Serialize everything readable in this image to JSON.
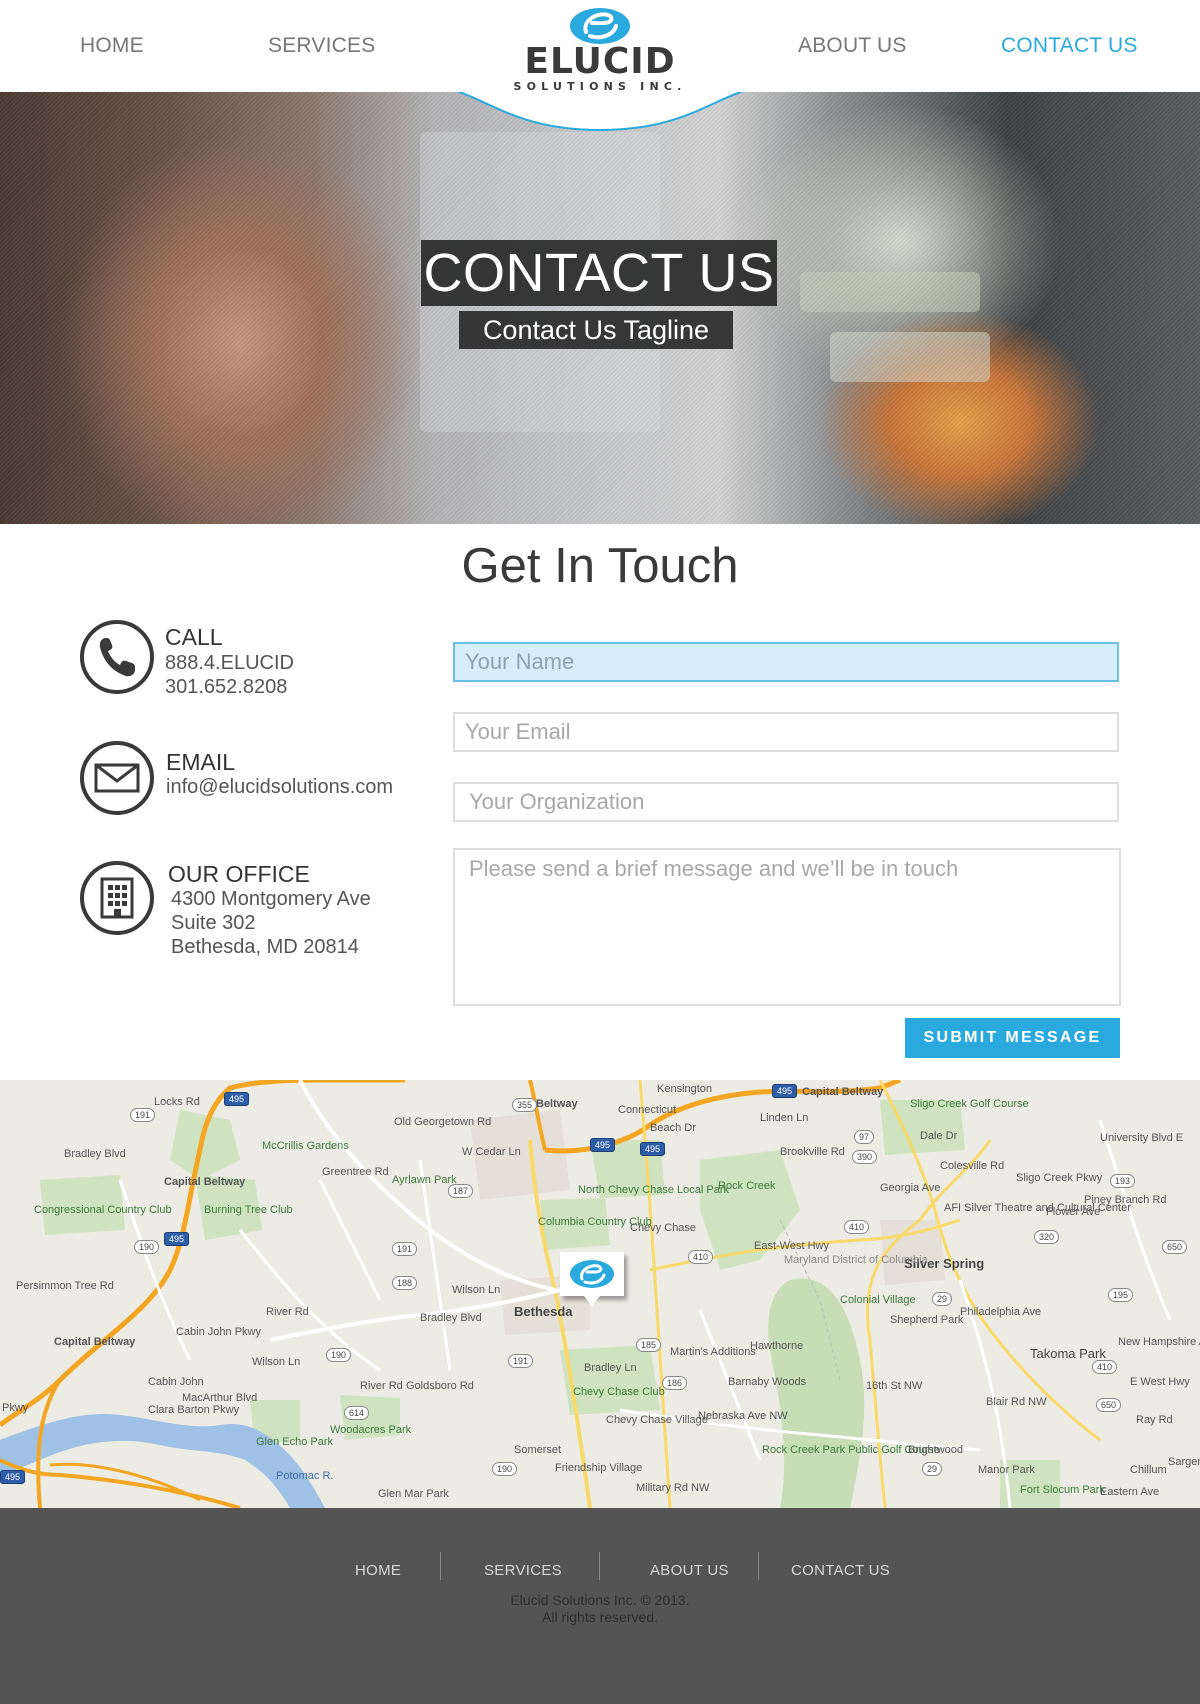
{
  "nav": {
    "home": "HOME",
    "services": "SERVICES",
    "about": "ABOUT US",
    "contact": "CONTACT US"
  },
  "logo": {
    "name": "ELUCID",
    "subtitle": "SOLUTIONS INC.",
    "icon": "elucid-e-mark-icon"
  },
  "hero": {
    "title": "CONTACT US",
    "tagline": "Contact Us Tagline"
  },
  "section_title": "Get In Touch",
  "contact": {
    "call": {
      "heading": "CALL",
      "line1": "888.4.ELUCID",
      "line2": "301.652.8208",
      "icon": "phone-icon"
    },
    "email": {
      "heading": "EMAIL",
      "address": "info@elucidsolutions.com",
      "icon": "envelope-icon"
    },
    "office": {
      "heading": "OUR OFFICE",
      "line1": "4300 Montgomery Ave",
      "line2": "Suite 302",
      "line3": "Bethesda, MD 20814",
      "icon": "building-icon"
    }
  },
  "form": {
    "name_placeholder": "Your Name",
    "email_placeholder": "Your Email",
    "org_placeholder": "Your Organization",
    "message_placeholder": "Please send a brief message and we’ll be in touch",
    "submit_label": "SUBMIT MESSAGE"
  },
  "map": {
    "labels": {
      "kensington": "Kensington",
      "capital_beltway_top": "Capital Beltway",
      "capital_beltway_left": "Capital Beltway",
      "capital_beltway_vert": "Capital Beltway",
      "sligo_creek": "Sligo Creek Golf Course",
      "linden_ln": "Linden Ln",
      "dale_dr": "Dale Dr",
      "mccrillis": "McCrillis Gardens",
      "ayrlawn": "Ayrlawn Park",
      "w_cedar": "W Cedar Ln",
      "north_chevy": "North Chevy Chase Local Park",
      "rock_creek": "Rock Creek",
      "afi": "AFI Silver Theatre and Cultural Center",
      "congressional": "Congressional Country Club",
      "burning_tree": "Burning Tree Club",
      "columbia": "Columbia Country Club",
      "chevy_chase": "Chevy Chase",
      "east_west": "East-West Hwy",
      "silver_spring": "Silver Spring",
      "piney_branch": "Piney Branch Rd",
      "wilson_ln": "Wilson Ln",
      "bethesda": "Bethesda",
      "colonial": "Colonial Village",
      "shepherd": "Shepherd Park",
      "takoma": "Takoma Park",
      "e_west_hwy": "E West Hwy",
      "hawthorne": "Hawthorne",
      "martins": "Martin's Additions",
      "barnaby": "Barnaby Woods",
      "bradley_ln": "Bradley Ln",
      "ccc": "Chevy Chase Club",
      "cabin_john": "Cabin John",
      "macarthur": "MacArthur Blvd",
      "clara_barton": "Clara Barton Pkwy",
      "goldsboro": "Goldsboro Rd",
      "woodacres": "Woodacres Park",
      "glen_echo": "Glen Echo Park",
      "ccv": "Chevy Chase Village",
      "somerset": "Somerset",
      "friendship": "Friendship Village",
      "rcp": "Rock Creek Park Public Golf Course",
      "brightwood": "Brightwood",
      "manor_park": "Manor Park",
      "chillum": "Chillum",
      "fort_slocum": "Fort Slocum Park",
      "military": "Military Rd NW",
      "glen_mar": "Glen Mar Park",
      "potomac": "Potomac R.",
      "pkwy": "Pkwy",
      "river_rd": "River Rd",
      "bradley_blvd": "Bradley Blvd",
      "old_georgetown": "Old Georgetown Rd",
      "greentree": "Greentree Rd",
      "persimmon": "Persimmon Tree Rd",
      "connecticut": "Connecticut",
      "beach_dr": "Beach Dr",
      "brookville": "Brookville Rd",
      "georgia": "Georgia Ave",
      "colesville": "Colesville Rd",
      "sligo_pkwy": "Sligo Creek Pkwy",
      "flower": "Flower Ave",
      "university": "University Blvd E",
      "new_hampshire": "New Hampshire Ave",
      "philadelphia": "Philadelphia Ave",
      "blair": "Blair Rd NW",
      "nebraska": "Nebraska Ave NW",
      "sixteenth": "16th St NW",
      "maryland": "Maryland District of Columbia",
      "ray_rd": "Ray Rd",
      "sargent": "Sargent Rd",
      "eastern": "Eastern Ave",
      "cabin_john_pkwy": "Cabin John Pkwy",
      "locks_rd": "Locks Rd",
      "bradley_blvd2": "Bradley Blvd",
      "river_rd2": "River Rd",
      "wilson_ln2": "Wilson Ln",
      "beltway_top2": "Beltway"
    },
    "shields": {
      "s191a": "191",
      "s355": "355",
      "s495a": "495",
      "s495b": "495",
      "s495c": "495",
      "s495d": "495",
      "s495e": "495",
      "s97": "97",
      "s390": "390",
      "s193": "193",
      "s187": "187",
      "s410a": "410",
      "s410b": "410",
      "s320": "320",
      "s650a": "650",
      "s190a": "190",
      "s191b": "191",
      "s188": "188",
      "s29a": "29",
      "s195": "195",
      "s185": "185",
      "s191c": "191",
      "s186": "186",
      "s190b": "190",
      "s614": "614",
      "s410c": "410",
      "s650b": "650",
      "s29b": "29",
      "s190c": "190",
      "s495f": "495"
    },
    "pin_icon": "elucid-map-pin-icon"
  },
  "footer": {
    "home": "HOME",
    "services": "SERVICES",
    "about": "ABOUT US",
    "contact": "CONTACT US",
    "copyright": "Elucid Solutions Inc. © 2013.",
    "rights": "All rights reserved."
  },
  "colors": {
    "accent": "#2aa9df",
    "footer_bg": "#545454",
    "text_dark": "#3a3a3a"
  }
}
